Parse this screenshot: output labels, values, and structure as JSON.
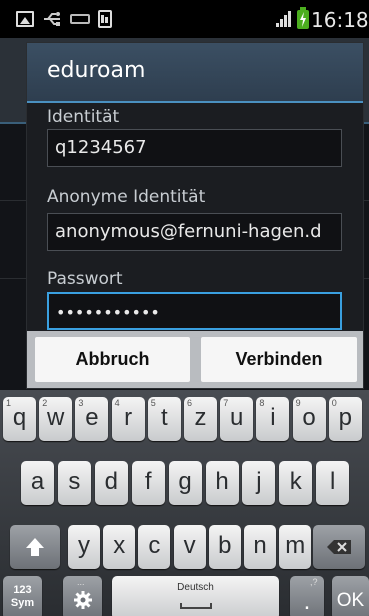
{
  "status_bar": {
    "time": "16:18",
    "icons": [
      "image-icon",
      "usb-icon",
      "keyboard-icon",
      "clipboard-icon",
      "signal-icon",
      "battery-charging-icon"
    ],
    "battery_color": "#4caf1f"
  },
  "dialog": {
    "title": "eduroam",
    "accent_color": "#3aa0e0",
    "fields": [
      {
        "label": "Identität",
        "value": "q1234567"
      },
      {
        "label": "Anonyme Identität",
        "value": "anonymous@fernuni-hagen.d"
      },
      {
        "label": "Passwort",
        "value": "•••••••••••"
      }
    ],
    "cancel_label": "Abbruch",
    "connect_label": "Verbinden"
  },
  "keyboard": {
    "row1": [
      {
        "main": "q",
        "sub": "1"
      },
      {
        "main": "w",
        "sub": "2"
      },
      {
        "main": "e",
        "sub": "3"
      },
      {
        "main": "r",
        "sub": "4"
      },
      {
        "main": "t",
        "sub": "5"
      },
      {
        "main": "z",
        "sub": "6"
      },
      {
        "main": "u",
        "sub": "7"
      },
      {
        "main": "i",
        "sub": "8"
      },
      {
        "main": "o",
        "sub": "9"
      },
      {
        "main": "p",
        "sub": "0"
      }
    ],
    "row2": [
      "a",
      "s",
      "d",
      "f",
      "g",
      "h",
      "j",
      "k",
      "l"
    ],
    "row3": [
      "y",
      "x",
      "c",
      "v",
      "b",
      "n",
      "m"
    ],
    "sym_label_top": "123",
    "sym_label_bottom": "Sym",
    "settings_hint": "...",
    "space_label": "Deutsch",
    "period_key": ".",
    "period_hint": ",?",
    "ok_label": "OK"
  }
}
